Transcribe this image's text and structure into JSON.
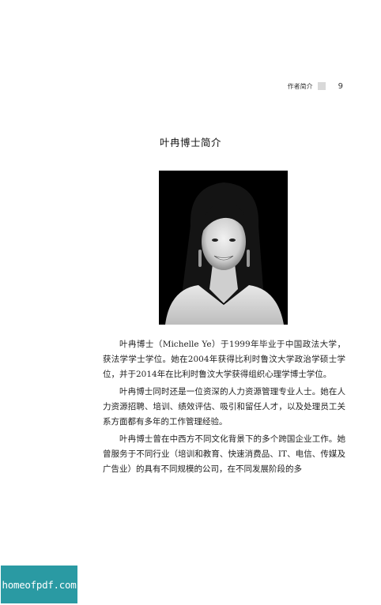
{
  "header": {
    "section_title": "作者简介",
    "page_number": "9"
  },
  "title": "叶冉博士简介",
  "photo": {
    "subject": "portrait-photo"
  },
  "paragraphs": [
    "叶冉博士（Michelle Ye）于1999年毕业于中国政法大学，获法学学士学位。她在2004年获得比利时鲁汶大学政治学硕士学位，并于2014年在比利时鲁汶大学获得组织心理学博士学位。",
    "叶冉博士同时还是一位资深的人力资源管理专业人士。她在人力资源招聘、培训、绩效评估、吸引和留任人才，以及处理员工关系方面都有多年的工作管理经验。",
    "叶冉博士曾在中西方不同文化背景下的多个跨国企业工作。她曾服务于不同行业（培训和教育、快速消费品、IT、电信、传媒及广告业）的具有不同规模的公司，在不同发展阶段的多"
  ],
  "watermark": {
    "text": "homeofpdf.com",
    "color": "#2a9aa3"
  }
}
